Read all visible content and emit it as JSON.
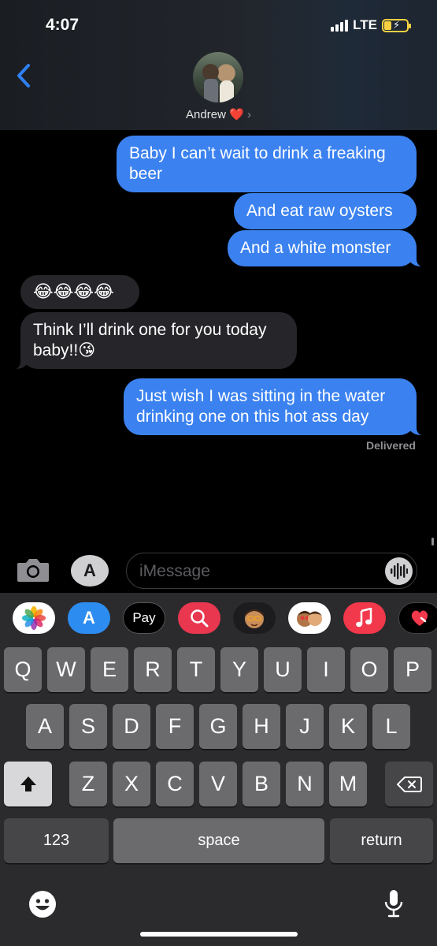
{
  "status_bar": {
    "time": "4:07",
    "network": "LTE"
  },
  "header": {
    "contact_name": "Andrew",
    "heart": "❤️",
    "chevron": "›"
  },
  "messages": [
    {
      "side": "sent",
      "text": "Baby I can’t wait to drink a freaking beer"
    },
    {
      "side": "sent",
      "text": "And eat raw oysters"
    },
    {
      "side": "sent",
      "text": "And a white monster"
    },
    {
      "side": "received",
      "text": "😂😂😂😂"
    },
    {
      "side": "received",
      "text": "Think I’ll drink one for you today baby!!😘"
    },
    {
      "side": "sent",
      "text": "Just wish I was sitting in the water drinking one on this hot ass day"
    }
  ],
  "delivered_label": "Delivered",
  "input": {
    "placeholder": "iMessage"
  },
  "app_strip": [
    "photos-icon",
    "app-store-icon",
    "apple-pay-icon",
    "image-search-icon",
    "memoji-icon",
    "memoji-stickers-icon",
    "music-icon",
    "digital-touch-icon"
  ],
  "apple_pay_label": "Pay",
  "keyboard": {
    "row1": [
      "Q",
      "W",
      "E",
      "R",
      "T",
      "Y",
      "U",
      "I",
      "O",
      "P"
    ],
    "row2": [
      "A",
      "S",
      "D",
      "F",
      "G",
      "H",
      "J",
      "K",
      "L"
    ],
    "row3": [
      "Z",
      "X",
      "C",
      "V",
      "B",
      "N",
      "M"
    ],
    "numbers_label": "123",
    "space_label": "space",
    "return_label": "return"
  },
  "colors": {
    "sent_bubble": "#3b82f0",
    "received_bubble": "#26262a",
    "background": "#000000"
  }
}
